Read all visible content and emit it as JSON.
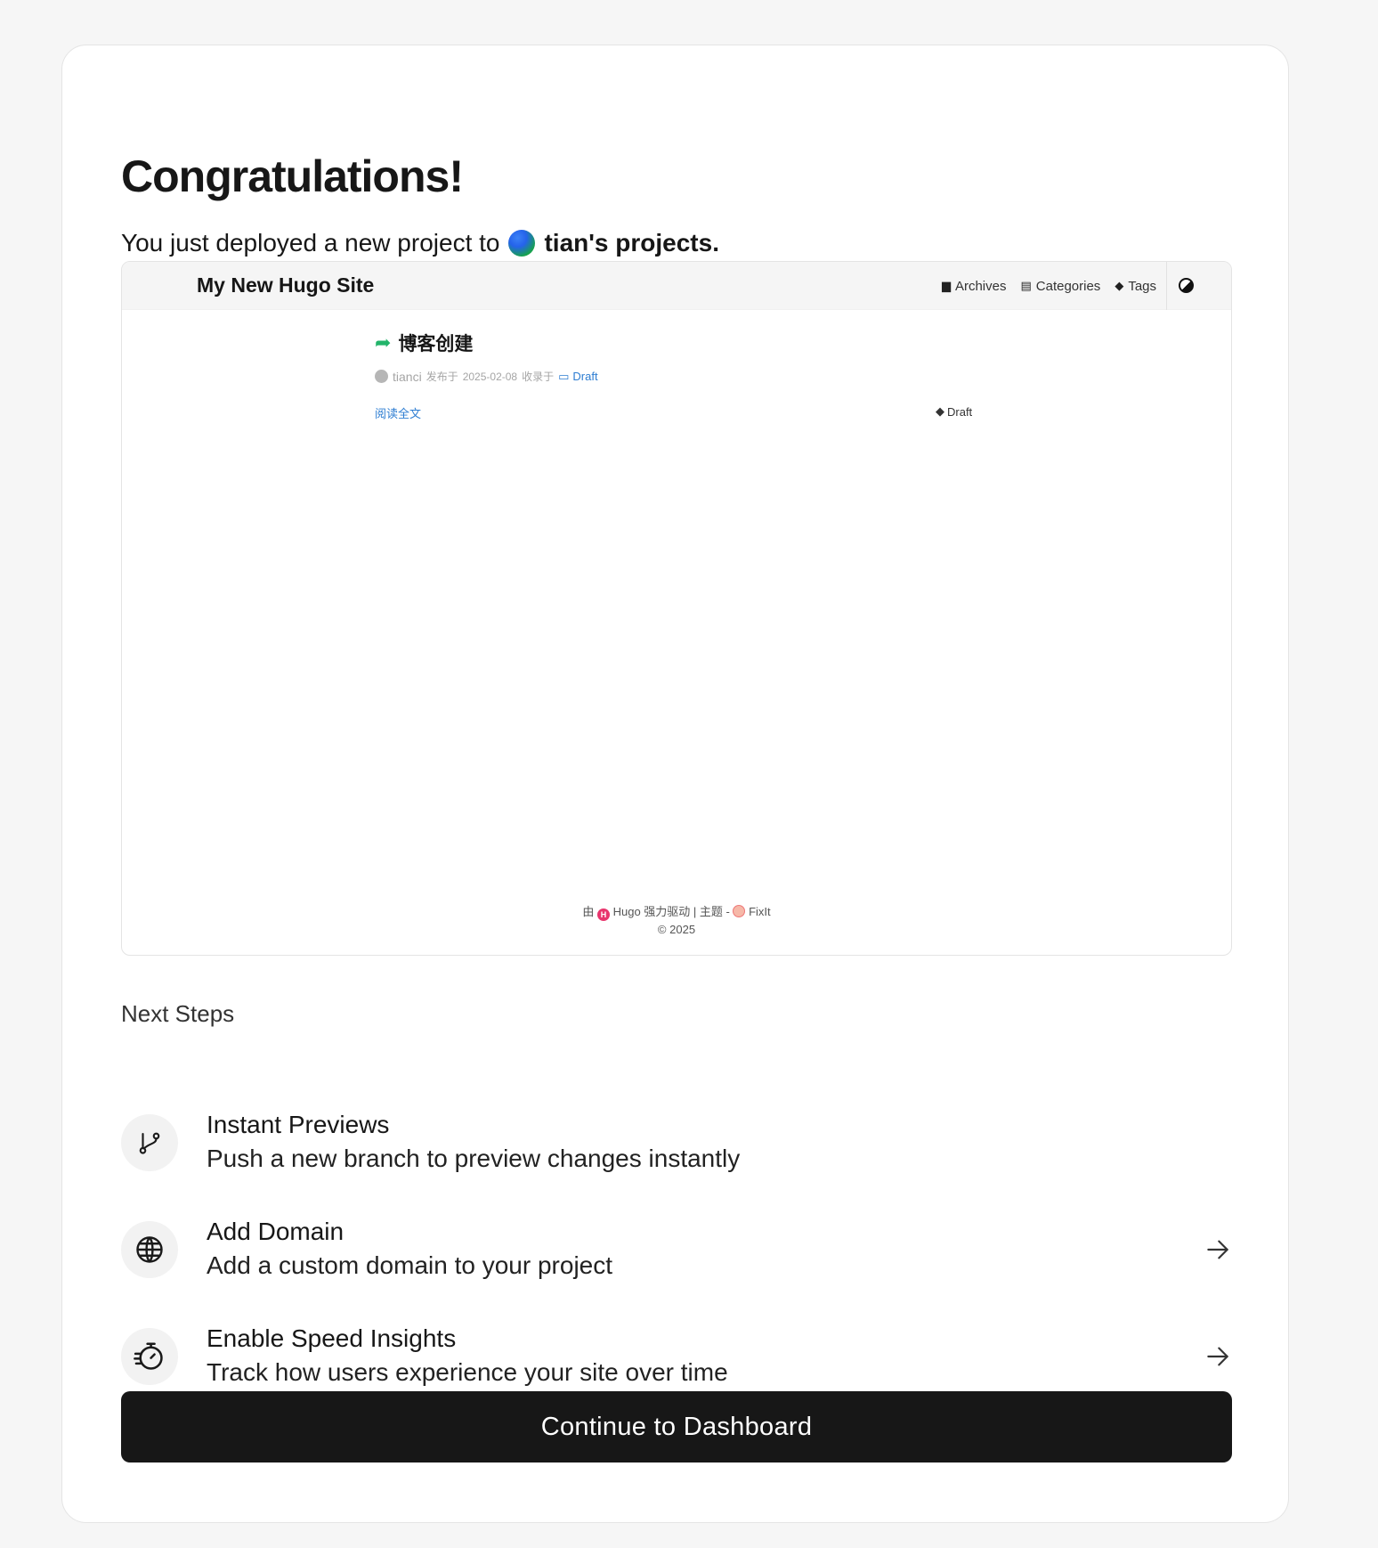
{
  "header": {
    "title": "Congratulations!",
    "subtitle_prefix": "You just deployed a new project to",
    "team_name": "tian's projects."
  },
  "preview": {
    "site_title": "My New Hugo Site",
    "nav": [
      {
        "label": "Archives",
        "icon": "archive-icon"
      },
      {
        "label": "Categories",
        "icon": "folder-tree-icon"
      },
      {
        "label": "Tags",
        "icon": "tags-icon"
      }
    ],
    "post": {
      "title": "博客创建",
      "author": "tianci",
      "published_prefix": "发布于",
      "date": "2025-02-08",
      "category_prefix": "收录于",
      "category": "Draft",
      "read_more": "阅读全文",
      "tag": "Draft"
    },
    "footer": {
      "powered_prefix": "由",
      "hugo": "Hugo",
      "powered_suffix": "强力驱动 | 主题 -",
      "theme": "FixIt",
      "copyright": "2025"
    }
  },
  "next_steps": {
    "label": "Next Steps",
    "items": [
      {
        "title": "Instant Previews",
        "description": "Push a new branch to preview changes instantly",
        "icon": "git-branch-icon"
      },
      {
        "title": "Add Domain",
        "description": "Add a custom domain to your project",
        "icon": "globe-icon"
      },
      {
        "title": "Enable Speed Insights",
        "description": "Track how users experience your site over time",
        "icon": "stopwatch-icon"
      }
    ]
  },
  "cta": {
    "label": "Continue to Dashboard"
  },
  "colors": {
    "primary_button": "#171717",
    "link": "#2d7dd2",
    "accent_green": "#22b46a"
  }
}
